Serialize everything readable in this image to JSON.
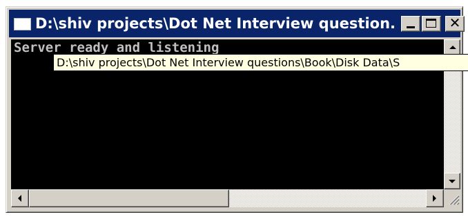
{
  "window": {
    "title": "D:\\shiv projects\\Dot Net Interview question...",
    "buttons": {
      "minimize": "minimize",
      "maximize": "maximize",
      "close": "✕"
    }
  },
  "console": {
    "output": "Server ready and listening"
  },
  "tooltip": {
    "text": "D:\\shiv projects\\Dot Net Interview questions\\Book\\Disk Data\\S"
  },
  "icons": [
    "app-icon",
    "minimize-icon",
    "maximize-icon",
    "close-icon",
    "arrow-up-icon",
    "arrow-down-icon",
    "arrow-left-icon",
    "arrow-right-icon",
    "size-grip-icon"
  ],
  "colors": {
    "titlebar": "#0a246a",
    "chrome": "#d4d0c8",
    "console_bg": "#000000",
    "console_text": "#c0c0c0",
    "tooltip_bg": "#ffffe1"
  }
}
